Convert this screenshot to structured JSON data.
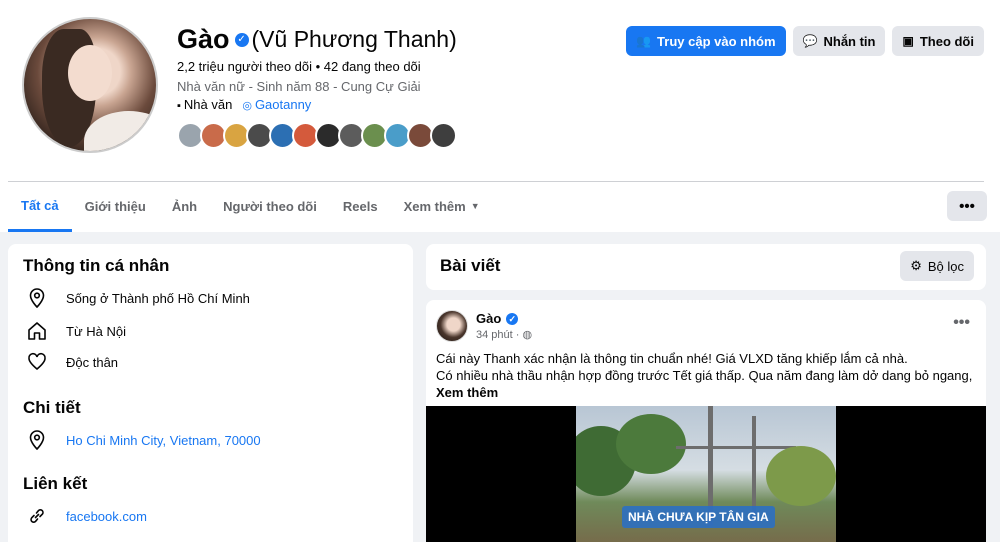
{
  "profile": {
    "name": "Gào",
    "alt_name": "(Vũ Phương Thanh)",
    "stats": "2,2 triệu người theo dõi • 42 đang theo dõi",
    "bio": "Nhà văn nữ - Sinh năm 88 - Cung Cự Giải",
    "job": "Nhà văn",
    "instagram": "Gaotanny",
    "follower_avatar_colors": [
      "#9aa4ad",
      "#c96b4a",
      "#d9a441",
      "#4b4b4b",
      "#2c6fb3",
      "#d45a3c",
      "#2b2b2b",
      "#5c5c5c",
      "#6b8f4e",
      "#4a9dc9",
      "#7a4a3a",
      "#3e3e3e"
    ]
  },
  "actions": {
    "join_group": "Truy cập vào nhóm",
    "message": "Nhắn tin",
    "follow": "Theo dõi"
  },
  "tabs": [
    {
      "label": "Tất cả",
      "active": true
    },
    {
      "label": "Giới thiệu"
    },
    {
      "label": "Ảnh"
    },
    {
      "label": "Người theo dõi"
    },
    {
      "label": "Reels"
    },
    {
      "label": "Xem thêm"
    }
  ],
  "more_menu": "•••",
  "about": {
    "title": "Thông tin cá nhân",
    "lives_in": "Sống ở Thành phố Hồ Chí Minh",
    "from": "Từ Hà Nội",
    "relationship": "Độc thân"
  },
  "details": {
    "title": "Chi tiết",
    "address": "Ho Chi Minh City, Vietnam, 70000"
  },
  "links": {
    "title": "Liên kết",
    "facebook": "facebook.com"
  },
  "posts": {
    "title": "Bài viết",
    "filter_label": "Bộ lọc"
  },
  "post": {
    "author": "Gào",
    "time": "34 phút · ",
    "line1": "Cái này Thanh xác nhận là thông tin chuẩn nhé! Giá VLXD tăng khiếp lắm cả nhà.",
    "line2": "Có nhiều nhà thầu nhận hợp đồng trước Tết giá thấp. Qua năm đang làm dở dang bỏ ngang, c...",
    "see_more": "Xem thêm",
    "video_caption": "NHÀ CHƯA KỊP TÂN GIA"
  },
  "colors": {
    "accent": "#1877f2",
    "secondary_text": "#65676b",
    "button_gray": "#e4e6eb"
  }
}
